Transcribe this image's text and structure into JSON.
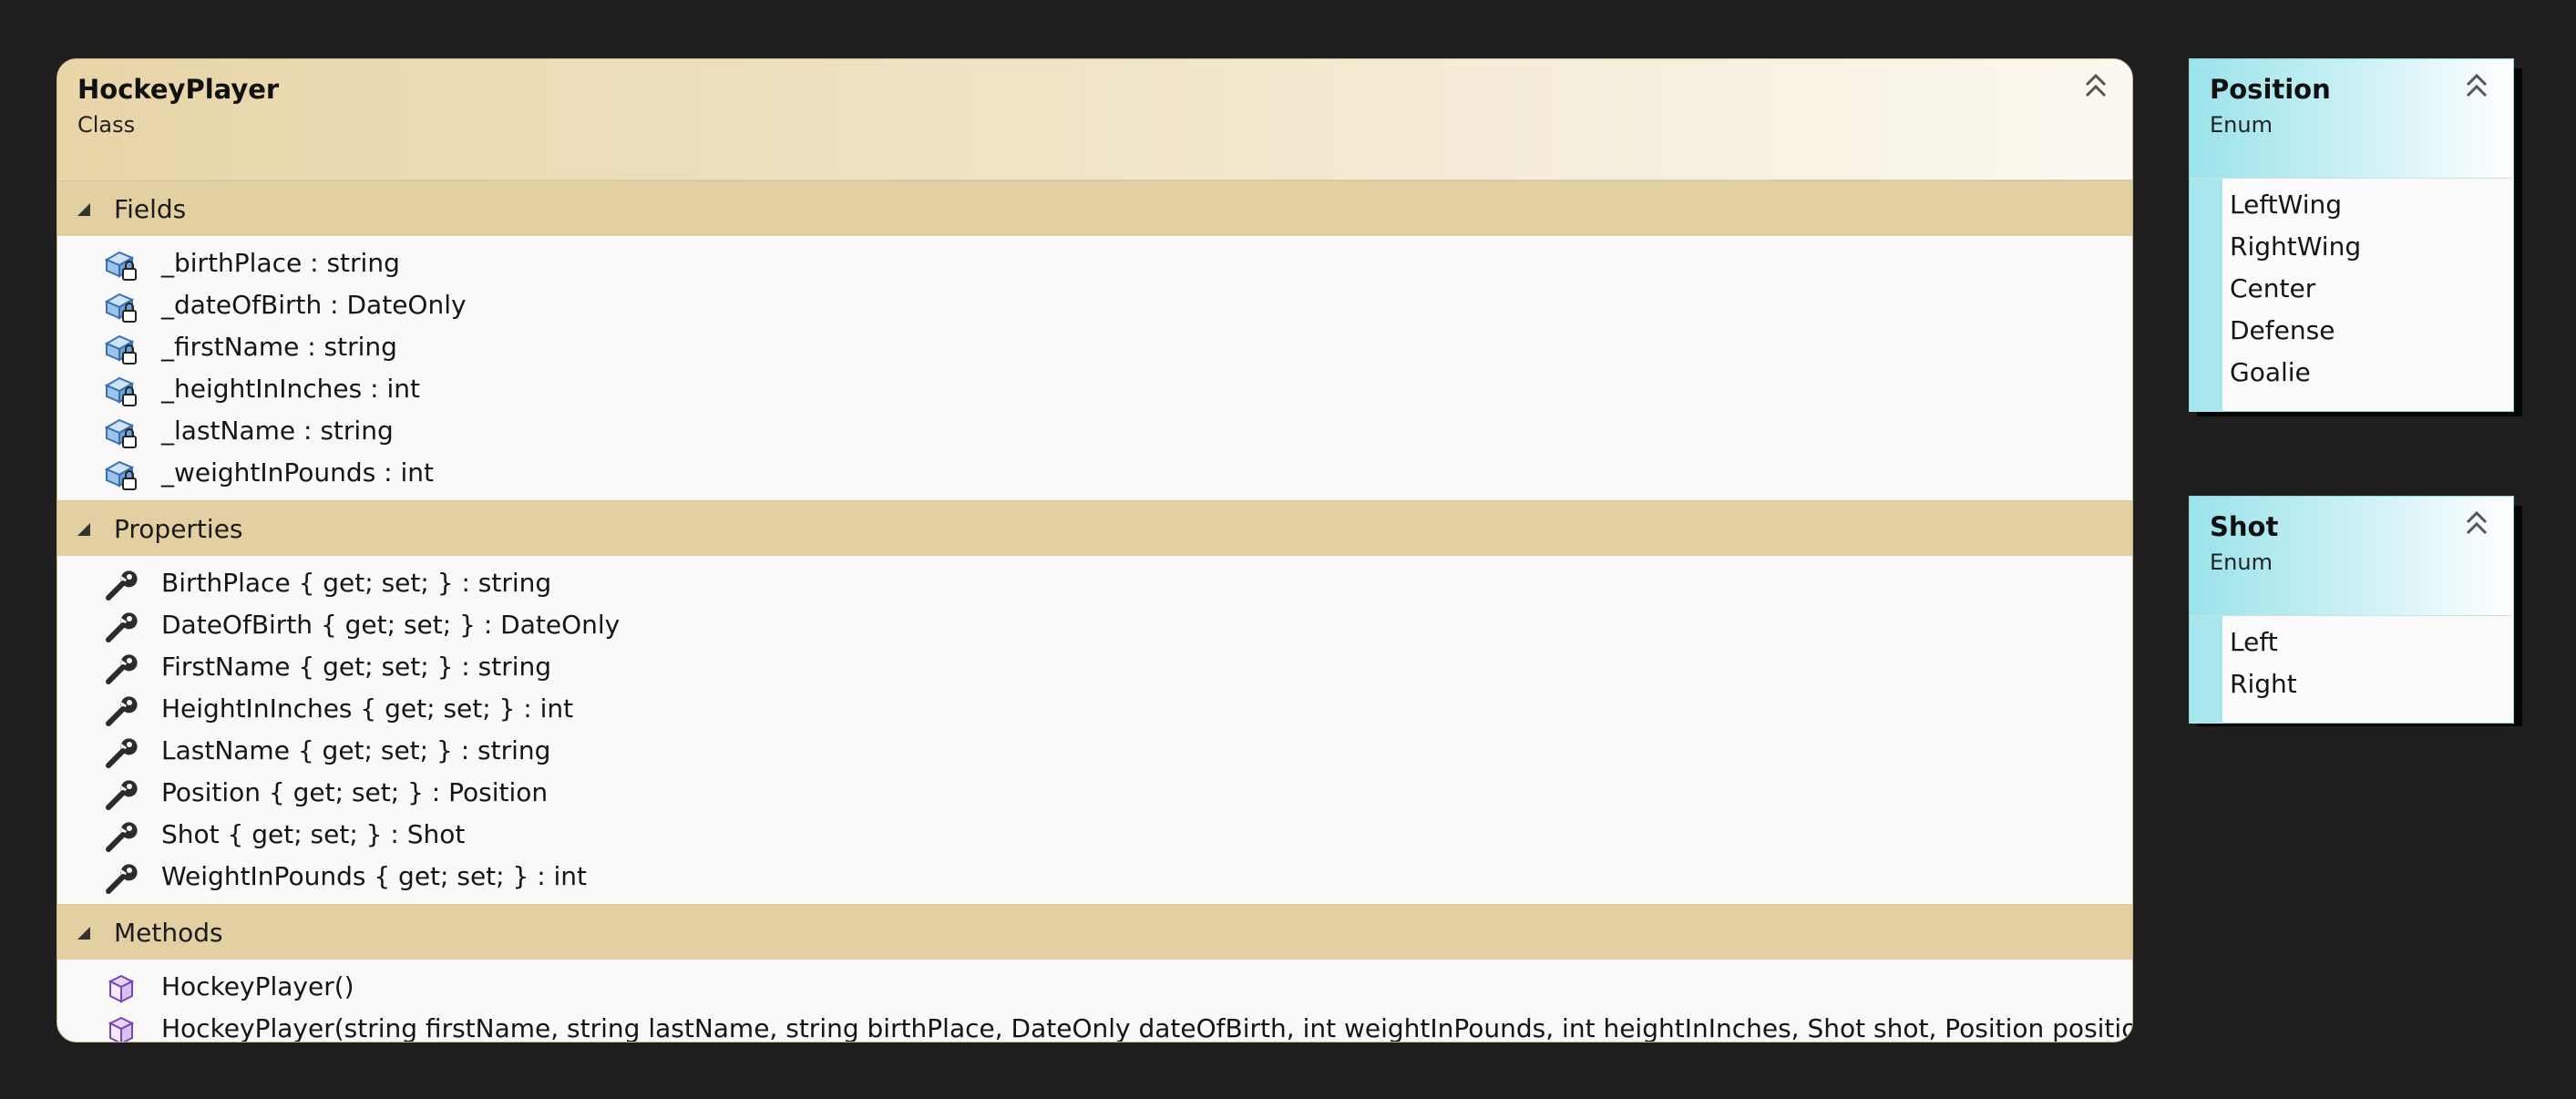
{
  "class_box": {
    "title": "HockeyPlayer",
    "kind": "Class",
    "compartments": {
      "fields": {
        "label": "Fields",
        "items": [
          "_birthPlace : string",
          "_dateOfBirth : DateOnly",
          "_firstName : string",
          "_heightInInches : int",
          "_lastName : string",
          "_weightInPounds : int"
        ]
      },
      "properties": {
        "label": "Properties",
        "items": [
          "BirthPlace { get; set; } : string",
          "DateOfBirth { get; set; } : DateOnly",
          "FirstName { get; set; } : string",
          "HeightInInches { get; set; } : int",
          "LastName { get; set; } : string",
          "Position { get; set; } : Position",
          "Shot { get; set; } : Shot",
          "WeightInPounds { get; set; } : int"
        ]
      },
      "methods": {
        "label": "Methods",
        "items": [
          "HockeyPlayer()",
          "HockeyPlayer(string firstName, string lastName, string birthPlace, DateOnly dateOfBirth, int weightInPounds, int heightInInches, Shot shot, Position position)"
        ]
      }
    }
  },
  "enums": {
    "position": {
      "title": "Position",
      "kind": "Enum",
      "items": [
        "LeftWing",
        "RightWing",
        "Center",
        "Defense",
        "Goalie"
      ]
    },
    "shot": {
      "title": "Shot",
      "kind": "Enum",
      "items": [
        "Left",
        "Right"
      ]
    }
  },
  "colors": {
    "background": "#1f1f1f",
    "class_header": "#e8d5a8",
    "compartment": "#e2d0a2",
    "enum_header": "#9be3ea"
  },
  "icons": {
    "field": "private-field-icon",
    "property": "wrench-property-icon",
    "method": "method-cube-icon",
    "collapse": "double-chevron-up-icon"
  }
}
